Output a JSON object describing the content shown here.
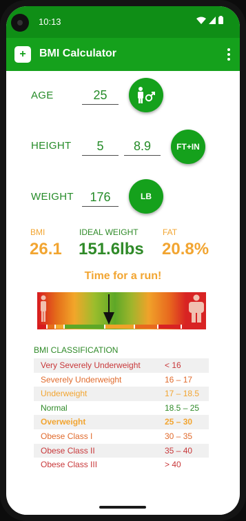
{
  "status": {
    "time": "10:13"
  },
  "app": {
    "title": "BMI Calculator"
  },
  "inputs": {
    "age_label": "AGE",
    "age_value": "25",
    "height_label": "HEIGHT",
    "height_ft": "5",
    "height_in": "8.9",
    "height_unit": "FT+IN",
    "weight_label": "WEIGHT",
    "weight_value": "176",
    "weight_unit": "LB"
  },
  "results": {
    "bmi_label": "BMI",
    "bmi_value": "26.1",
    "ideal_label": "IDEAL WEIGHT",
    "ideal_value": "151.6lbs",
    "fat_label": "FAT",
    "fat_value": "20.8%",
    "message": "Time for a run!"
  },
  "colors": {
    "green": "#15a11c",
    "orange": "#f2a531",
    "red": "#c8383a",
    "dark_green": "#258b28"
  },
  "classification": {
    "title": "BMI CLASSIFICATION",
    "rows": [
      {
        "name": "Very Severely Underweight",
        "range": "< 16",
        "color": "#c8383a"
      },
      {
        "name": "Severely Underweight",
        "range": "16 – 17",
        "color": "#e06a2c"
      },
      {
        "name": "Underweight",
        "range": "17 – 18.5",
        "color": "#f2a531"
      },
      {
        "name": "Normal",
        "range": "18.5 – 25",
        "color": "#2f8a28"
      },
      {
        "name": "Overweight",
        "range": "25 – 30",
        "color": "#f2a531",
        "bold": true
      },
      {
        "name": "Obese Class I",
        "range": "30 – 35",
        "color": "#e06a2c"
      },
      {
        "name": "Obese Class II",
        "range": "35 – 40",
        "color": "#c8383a"
      },
      {
        "name": "Obese Class III",
        "range": "> 40",
        "color": "#c8383a"
      }
    ]
  }
}
